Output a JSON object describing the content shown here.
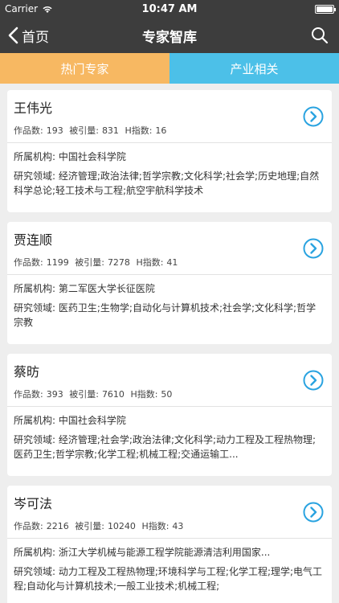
{
  "status_bar": {
    "carrier": "Carrier",
    "time": "10:47 AM",
    "battery_level": 1.0
  },
  "nav": {
    "back_label": "首页",
    "title": "专家智库"
  },
  "tabs": [
    {
      "label": "热门专家",
      "color": "#f7b862"
    },
    {
      "label": "产业相关",
      "color": "#4cc0e8"
    }
  ],
  "colors": {
    "nav_bg": "#3d3d3d",
    "accent_blue": "#2aa3e0",
    "page_bg": "#eeeeee"
  },
  "labels": {
    "works": "作品数:",
    "cited": "被引量:",
    "h_index": "H指数:",
    "org": "所属机构:",
    "field": "研究领域:"
  },
  "experts": [
    {
      "name": "王伟光",
      "works": "193",
      "cited": "831",
      "h_index": "16",
      "org": "中国社会科学院",
      "field": "经济管理;政治法律;哲学宗教;文化科学;社会学;历史地理;自然科学总论;轻工技术与工程;航空宇航科学技术"
    },
    {
      "name": "贾连顺",
      "works": "1199",
      "cited": "7278",
      "h_index": "41",
      "org": "第二军医大学长征医院",
      "field": "医药卫生;生物学;自动化与计算机技术;社会学;文化科学;哲学宗教"
    },
    {
      "name": "蔡昉",
      "works": "393",
      "cited": "7610",
      "h_index": "50",
      "org": "中国社会科学院",
      "field": "经济管理;社会学;政治法律;文化科学;动力工程及工程热物理;医药卫生;哲学宗教;化学工程;机械工程;交通运输工..."
    },
    {
      "name": "岑可法",
      "works": "2216",
      "cited": "10240",
      "h_index": "43",
      "org": "浙江大学机械与能源工程学院能源清洁利用国家...",
      "field": "动力工程及工程热物理;环境科学与工程;化学工程;理学;电气工程;自动化与计算机技术;一般工业技术;机械工程;"
    }
  ]
}
